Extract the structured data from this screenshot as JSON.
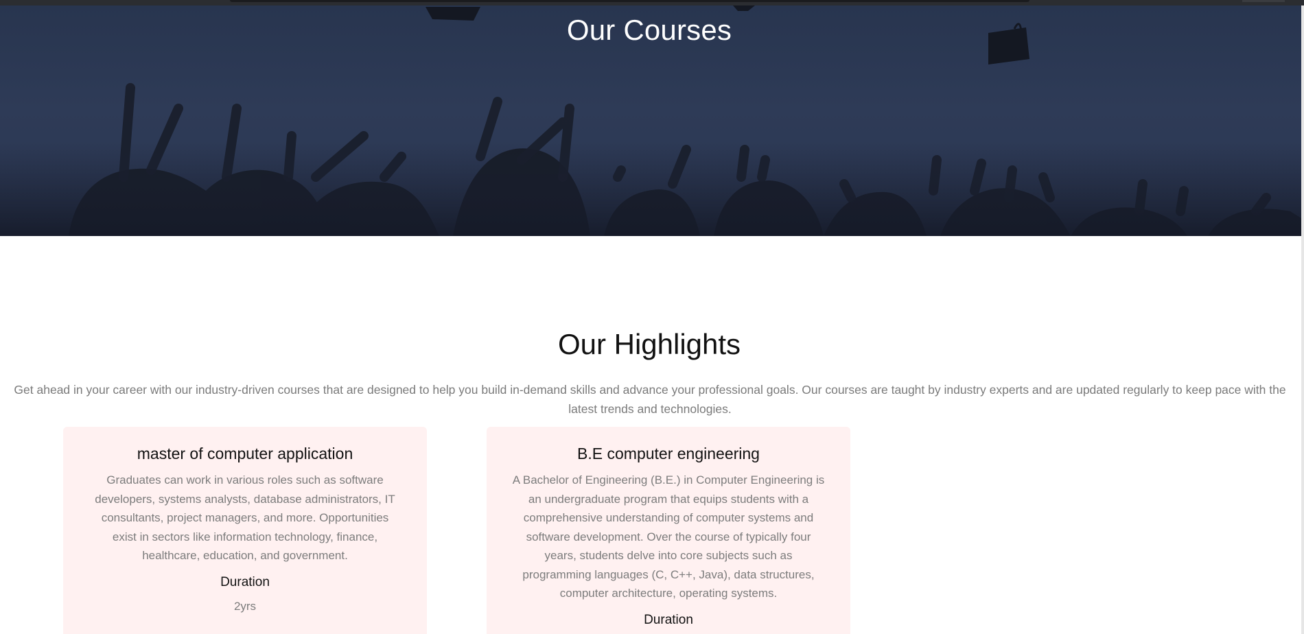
{
  "hero": {
    "title": "Our Courses"
  },
  "highlights": {
    "title": "Our Highlights",
    "subtitle": "Get ahead in your career with our industry-driven courses that are designed to help you build in-demand skills and advance your professional goals. Our courses are taught by industry experts and are updated regularly to keep pace with the latest trends and technologies."
  },
  "courses": [
    {
      "title": "master of computer application",
      "description": "Graduates can work in various roles such as software developers, systems analysts, database administrators, IT consultants, project managers, and more. Opportunities exist in sectors like information technology, finance, healthcare, education, and government.",
      "duration_label": "Duration",
      "duration_value": "2yrs"
    },
    {
      "title": "B.E computer engineering",
      "description": "A Bachelor of Engineering (B.E.) in Computer Engineering is an undergraduate program that equips students with a comprehensive understanding of computer systems and software development. Over the course of typically four years, students delve into core subjects such as programming languages (C, C++, Java), data structures, computer architecture, operating systems.",
      "duration_label": "Duration"
    }
  ],
  "colors": {
    "hero_overlay": "#2a3651",
    "card_background": "#fff1f1",
    "muted_text": "#7c7c7c"
  }
}
